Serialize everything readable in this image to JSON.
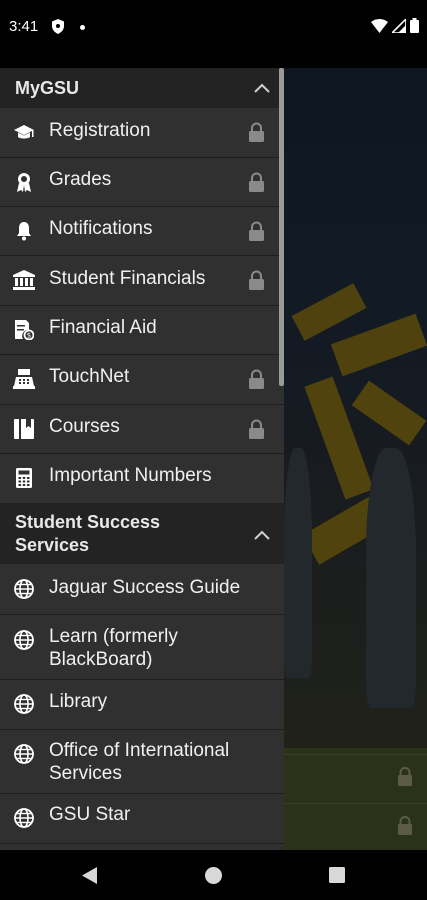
{
  "status_bar": {
    "time": "3:41",
    "icons": [
      "shield-icon",
      "notification-dot-icon",
      "wifi-icon",
      "cell-signal-icon",
      "battery-icon"
    ]
  },
  "drawer": {
    "sections": [
      {
        "title": "MyGSU",
        "expanded": true,
        "items": [
          {
            "label": "Registration",
            "icon": "graduation-cap-icon",
            "locked": true
          },
          {
            "label": "Grades",
            "icon": "award-ribbon-icon",
            "locked": true
          },
          {
            "label": "Notifications",
            "icon": "bell-icon",
            "locked": true
          },
          {
            "label": "Student Financials",
            "icon": "bank-icon",
            "locked": true
          },
          {
            "label": "Financial Aid",
            "icon": "financial-aid-document-icon",
            "locked": false
          },
          {
            "label": "TouchNet",
            "icon": "cash-register-icon",
            "locked": true
          },
          {
            "label": "Courses",
            "icon": "notebook-icon",
            "locked": true
          },
          {
            "label": "Important Numbers",
            "icon": "calculator-icon",
            "locked": false
          }
        ]
      },
      {
        "title": "Student Success Services",
        "expanded": true,
        "items": [
          {
            "label": "Jaguar Success Guide",
            "icon": "globe-icon",
            "locked": false
          },
          {
            "label": "Learn (formerly BlackBoard)",
            "icon": "globe-icon",
            "locked": false
          },
          {
            "label": "Library",
            "icon": "globe-icon",
            "locked": false
          },
          {
            "label": "Office of International Services",
            "icon": "globe-icon",
            "locked": false
          },
          {
            "label": "GSU Star",
            "icon": "globe-icon",
            "locked": false
          }
        ]
      }
    ]
  },
  "nav_bar": {
    "buttons": [
      "back-icon",
      "home-icon",
      "recents-icon"
    ]
  },
  "colors": {
    "drawer_bg": "#303030",
    "section_header_bg": "#232323",
    "text": "#f0f0f0",
    "lock_icon": "#8a8a8a"
  }
}
